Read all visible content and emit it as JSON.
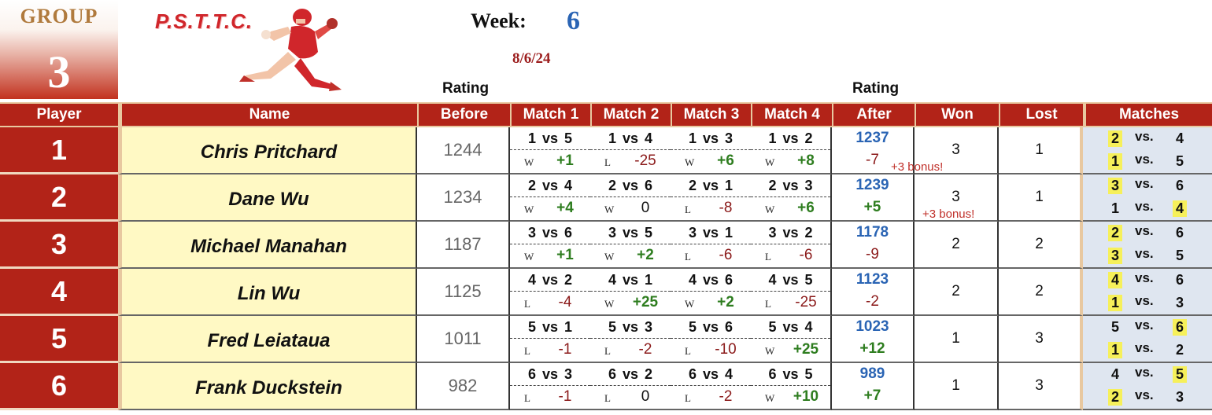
{
  "group": {
    "label": "GROUP",
    "number": "3"
  },
  "logo": {
    "text": "P.S.T.T.C."
  },
  "week": {
    "label": "Week:",
    "number": "6",
    "date": "8/6/24"
  },
  "labels": {
    "rating_before": "Rating",
    "rating_after": "Rating"
  },
  "headers": {
    "player": "Player",
    "name": "Name",
    "before": "Before",
    "match1": "Match 1",
    "match2": "Match 2",
    "match3": "Match 3",
    "match4": "Match 4",
    "after": "After",
    "won": "Won",
    "lost": "Lost",
    "matches": "Matches"
  },
  "colors": {
    "header_red": "#b22318",
    "name_fill": "#fff9c4",
    "rating_blue": "#2a64b4",
    "win_green": "#2e7d1f",
    "loss_red": "#8b1a1a",
    "highlight": "#f6f05a"
  },
  "players": [
    {
      "num": "1",
      "name": "Chris Pritchard",
      "before": "1244",
      "after": "1237",
      "delta": "-7",
      "delta_type": "neg",
      "won": "3",
      "lost": "1",
      "matches": [
        {
          "p": "1",
          "o": "5",
          "wl": "W",
          "d": "+1",
          "t": "pos"
        },
        {
          "p": "1",
          "o": "4",
          "wl": "L",
          "d": "-25",
          "t": "neg"
        },
        {
          "p": "1",
          "o": "3",
          "wl": "W",
          "d": "+6",
          "t": "pos"
        },
        {
          "p": "1",
          "o": "2",
          "wl": "W",
          "d": "+8",
          "t": "pos"
        }
      ],
      "pairs": [
        {
          "a": "2",
          "b": "4",
          "ha": true,
          "hb": false
        },
        {
          "a": "1",
          "b": "5",
          "ha": true,
          "hb": false
        }
      ],
      "bonus": "+3 bonus!"
    },
    {
      "num": "2",
      "name": "Dane Wu",
      "before": "1234",
      "after": "1239",
      "delta": "+5",
      "delta_type": "pos",
      "won": "3",
      "lost": "1",
      "matches": [
        {
          "p": "2",
          "o": "4",
          "wl": "W",
          "d": "+4",
          "t": "pos"
        },
        {
          "p": "2",
          "o": "6",
          "wl": "W",
          "d": "0",
          "t": "zero"
        },
        {
          "p": "2",
          "o": "1",
          "wl": "L",
          "d": "-8",
          "t": "neg"
        },
        {
          "p": "2",
          "o": "3",
          "wl": "W",
          "d": "+6",
          "t": "pos"
        }
      ],
      "pairs": [
        {
          "a": "3",
          "b": "6",
          "ha": true,
          "hb": false
        },
        {
          "a": "1",
          "b": "4",
          "ha": false,
          "hb": true
        }
      ],
      "bonus": "+3 bonus!"
    },
    {
      "num": "3",
      "name": "Michael Manahan",
      "before": "1187",
      "after": "1178",
      "delta": "-9",
      "delta_type": "neg",
      "won": "2",
      "lost": "2",
      "matches": [
        {
          "p": "3",
          "o": "6",
          "wl": "W",
          "d": "+1",
          "t": "pos"
        },
        {
          "p": "3",
          "o": "5",
          "wl": "W",
          "d": "+2",
          "t": "pos"
        },
        {
          "p": "3",
          "o": "1",
          "wl": "L",
          "d": "-6",
          "t": "neg"
        },
        {
          "p": "3",
          "o": "2",
          "wl": "L",
          "d": "-6",
          "t": "neg"
        }
      ],
      "pairs": [
        {
          "a": "2",
          "b": "6",
          "ha": true,
          "hb": false
        },
        {
          "a": "3",
          "b": "5",
          "ha": true,
          "hb": false
        }
      ]
    },
    {
      "num": "4",
      "name": "Lin Wu",
      "before": "1125",
      "after": "1123",
      "delta": "-2",
      "delta_type": "neg",
      "won": "2",
      "lost": "2",
      "matches": [
        {
          "p": "4",
          "o": "2",
          "wl": "L",
          "d": "-4",
          "t": "neg"
        },
        {
          "p": "4",
          "o": "1",
          "wl": "W",
          "d": "+25",
          "t": "pos"
        },
        {
          "p": "4",
          "o": "6",
          "wl": "W",
          "d": "+2",
          "t": "pos"
        },
        {
          "p": "4",
          "o": "5",
          "wl": "L",
          "d": "-25",
          "t": "neg"
        }
      ],
      "pairs": [
        {
          "a": "4",
          "b": "6",
          "ha": true,
          "hb": false
        },
        {
          "a": "1",
          "b": "3",
          "ha": true,
          "hb": false
        }
      ]
    },
    {
      "num": "5",
      "name": "Fred Leiataua",
      "before": "1011",
      "after": "1023",
      "delta": "+12",
      "delta_type": "pos",
      "won": "1",
      "lost": "3",
      "matches": [
        {
          "p": "5",
          "o": "1",
          "wl": "L",
          "d": "-1",
          "t": "neg"
        },
        {
          "p": "5",
          "o": "3",
          "wl": "L",
          "d": "-2",
          "t": "neg"
        },
        {
          "p": "5",
          "o": "6",
          "wl": "L",
          "d": "-10",
          "t": "neg"
        },
        {
          "p": "5",
          "o": "4",
          "wl": "W",
          "d": "+25",
          "t": "pos"
        }
      ],
      "pairs": [
        {
          "a": "5",
          "b": "6",
          "ha": false,
          "hb": true
        },
        {
          "a": "1",
          "b": "2",
          "ha": true,
          "hb": false
        }
      ]
    },
    {
      "num": "6",
      "name": "Frank Duckstein",
      "before": "982",
      "after": "989",
      "delta": "+7",
      "delta_type": "pos",
      "won": "1",
      "lost": "3",
      "matches": [
        {
          "p": "6",
          "o": "3",
          "wl": "L",
          "d": "-1",
          "t": "neg"
        },
        {
          "p": "6",
          "o": "2",
          "wl": "L",
          "d": "0",
          "t": "zero"
        },
        {
          "p": "6",
          "o": "4",
          "wl": "L",
          "d": "-2",
          "t": "neg"
        },
        {
          "p": "6",
          "o": "5",
          "wl": "W",
          "d": "+10",
          "t": "pos"
        }
      ],
      "pairs": [
        {
          "a": "4",
          "b": "5",
          "ha": false,
          "hb": true
        },
        {
          "a": "2",
          "b": "3",
          "ha": true,
          "hb": false
        }
      ]
    }
  ]
}
